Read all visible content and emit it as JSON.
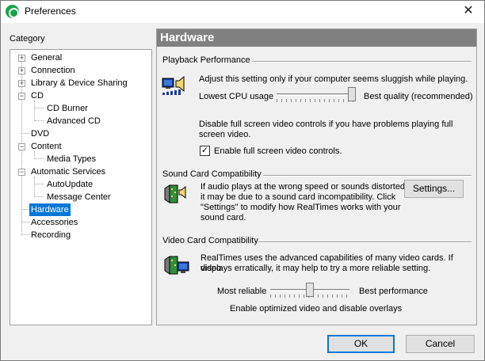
{
  "window": {
    "title": "Preferences",
    "close_glyph": "✕"
  },
  "category": {
    "label": "Category",
    "items": [
      {
        "label": "General",
        "expander": "+"
      },
      {
        "label": "Connection",
        "expander": "+"
      },
      {
        "label": "Library & Device Sharing",
        "expander": "+"
      },
      {
        "label": "CD",
        "expander": "−"
      },
      {
        "label": "CD Burner"
      },
      {
        "label": "Advanced CD"
      },
      {
        "label": "DVD"
      },
      {
        "label": "Content",
        "expander": "−"
      },
      {
        "label": "Media Types"
      },
      {
        "label": "Automatic Services",
        "expander": "−"
      },
      {
        "label": "AutoUpdate"
      },
      {
        "label": "Message Center"
      },
      {
        "label": "Hardware",
        "selected": true
      },
      {
        "label": "Accessories"
      },
      {
        "label": "Recording"
      }
    ]
  },
  "panel": {
    "title": "Hardware",
    "playback": {
      "title": "Playback Performance",
      "desc": "Adjust this setting only if your computer seems sluggish while playing.",
      "slider_low": "Lowest CPU usage",
      "slider_high": "Best quality (recommended)",
      "slider_value": 1.0,
      "fullscreen_desc_1": "Disable full screen video controls if you have problems playing full",
      "fullscreen_desc_2": "screen video.",
      "fullscreen_checkbox": "Enable full screen video controls.",
      "fullscreen_checked": true,
      "check_glyph": "✓"
    },
    "sound": {
      "title": "Sound Card Compatibility",
      "line1": "If audio plays at the wrong speed or sounds distorted,",
      "line2": "it may be due to a sound card incompatibility.  Click",
      "line3": "\"Settings\" to modify how RealTimes works with your",
      "line4": "sound card.",
      "settings_button": "Settings..."
    },
    "video": {
      "title": "Video Card Compatibility",
      "line1": "RealTimes uses the advanced capabilities of many video cards. If video",
      "line2": "displays erratically, it may help to try a more reliable setting.",
      "slider_low": "Most reliable",
      "slider_high": "Best performance",
      "slider_value": 0.5,
      "slider_caption": "Enable optimized video and disable overlays"
    }
  },
  "buttons": {
    "ok": "OK",
    "cancel": "Cancel"
  },
  "colors": {
    "selection": "#0078d7",
    "header_bg": "#808080",
    "app_icon": "#1aa34a"
  }
}
